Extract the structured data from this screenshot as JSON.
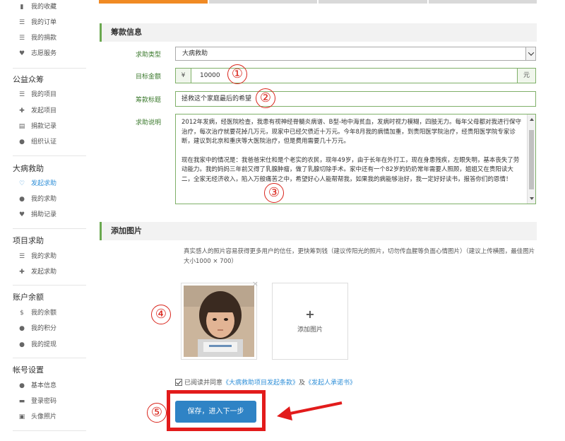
{
  "sidebar": {
    "top_items": [
      {
        "label": "我的收藏",
        "icon": "bookmark-icon"
      },
      {
        "label": "我的订单",
        "icon": "list-icon"
      },
      {
        "label": "我的捐款",
        "icon": "list-icon"
      },
      {
        "label": "志愿服务",
        "icon": "heart-icon"
      }
    ],
    "groups": [
      {
        "title": "公益众筹",
        "items": [
          {
            "label": "我的项目",
            "icon": "list-icon"
          },
          {
            "label": "发起项目",
            "icon": "plus-icon"
          },
          {
            "label": "捐款记录",
            "icon": "doc-icon"
          },
          {
            "label": "组织认证",
            "icon": "check-circle-icon"
          }
        ]
      },
      {
        "title": "大病救助",
        "items": [
          {
            "label": "发起求助",
            "icon": "heart-outline-icon",
            "active": true
          },
          {
            "label": "我的求助",
            "icon": "info-icon"
          },
          {
            "label": "捐助记录",
            "icon": "heart-icon"
          }
        ]
      },
      {
        "title": "项目求助",
        "items": [
          {
            "label": "我的求助",
            "icon": "list-icon"
          },
          {
            "label": "发起求助",
            "icon": "plus-icon"
          }
        ]
      },
      {
        "title": "账户余额",
        "items": [
          {
            "label": "我的余额",
            "icon": "dollar-icon"
          },
          {
            "label": "我的积分",
            "icon": "info-icon"
          },
          {
            "label": "我的提现",
            "icon": "info-icon"
          }
        ]
      },
      {
        "title": "帐号设置",
        "items": [
          {
            "label": "基本信息",
            "icon": "user-icon"
          },
          {
            "label": "登录密码",
            "icon": "lock-icon"
          },
          {
            "label": "头像照片",
            "icon": "image-icon"
          }
        ]
      }
    ]
  },
  "sections": {
    "fund_info": "筹款信息",
    "add_image": "添加图片"
  },
  "form": {
    "type_label": "求助类型",
    "type_value": "大病救助",
    "target_label": "目标金额",
    "currency_symbol": "¥",
    "target_value": "10000",
    "unit": "元",
    "title_label": "筹款标题",
    "title_value": "拯救这个家庭最后的希望",
    "desc_label": "求助说明",
    "desc_p1": "2012年发病，经医院检查，我患有视神经脊髓炎病谱、B型-地中海贫血，发病时视力模糊，四肢无力。每年父母都对我进行保守治疗，每次治疗就要花掉几万元，现家中已经欠债近十万元。今年8月我的病情加重，到贵阳医学院治疗，经贵阳医学院专家诊断，建议到北京和重庆等大医院治疗，但是费用需要几十万元。",
    "desc_p2": "现在我家中的情况是：我爸爸宋仕和是个老实的农民，现年49岁，由于长年在外打工，现在身患残疾，左眼失明，基本丧失了劳动能力。我的妈妈三年前又得了乳腺肿瘤，做了乳腺切除手术。家中还有一个82岁的奶奶常年需要人照顾，姐姐又在贵阳读大二，全家无经济收入，陷入万般痛苦之中，希望好心人能帮帮我，如果我的病能够治好，我一定好好读书，报答你们的恩情！"
  },
  "image_section": {
    "hint": "真实感人的照片容易获得更多用户的信任，更快筹到钱（建议传阳光的照片，切勿传血腥等负面心情图片）（建议上传横图，最佳图片大小1000 × 700）",
    "add_label": "添加图片",
    "close_symbol": "×",
    "plus_symbol": "+"
  },
  "agreement": {
    "prefix": "已阅读并同意",
    "link1": "《大病救助项目发起条款》",
    "middle": "及",
    "link2": "《发起人承诺书》"
  },
  "submit_label": "保存，进入下一步",
  "markers": [
    "①",
    "②",
    "③",
    "④",
    "⑤"
  ],
  "colors": {
    "accent_green": "#6aa84f",
    "primary_blue": "#2f83c5",
    "annotation_red": "#e21b1b",
    "progress_orange": "#f08a24"
  }
}
